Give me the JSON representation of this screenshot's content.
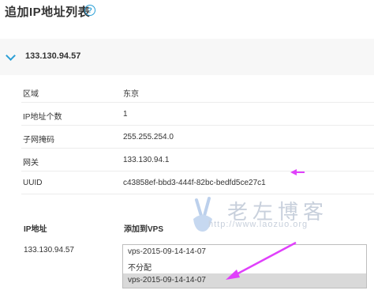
{
  "page": {
    "title": "追加IP地址列表",
    "help_icon": "question-circle-icon"
  },
  "header": {
    "ip": "133.130.94.57",
    "toggle_icon": "chevron-down-icon"
  },
  "details": [
    {
      "key": "区域",
      "value": "东京"
    },
    {
      "key": "IP地址个数",
      "value": "1"
    },
    {
      "key": "子网掩码",
      "value": "255.255.254.0"
    },
    {
      "key": "网关",
      "value": "133.130.94.1"
    },
    {
      "key": "UUID",
      "value": "c43858ef-bbd3-444f-82bc-bedfd5ce27c1"
    }
  ],
  "assign": {
    "col_ip": "IP地址",
    "col_vps": "添加到VPS",
    "row_ip": "133.130.94.57",
    "selected": "vps-2015-09-14-14-07",
    "options": [
      "不分配",
      "vps-2015-09-14-14-07"
    ]
  },
  "watermark": {
    "text": "老左博客",
    "url": "http://www.laozuo.org"
  },
  "colors": {
    "accent": "#2a9fd6",
    "arrow": "#e040fb",
    "selected_option": "#d9d9d9"
  }
}
